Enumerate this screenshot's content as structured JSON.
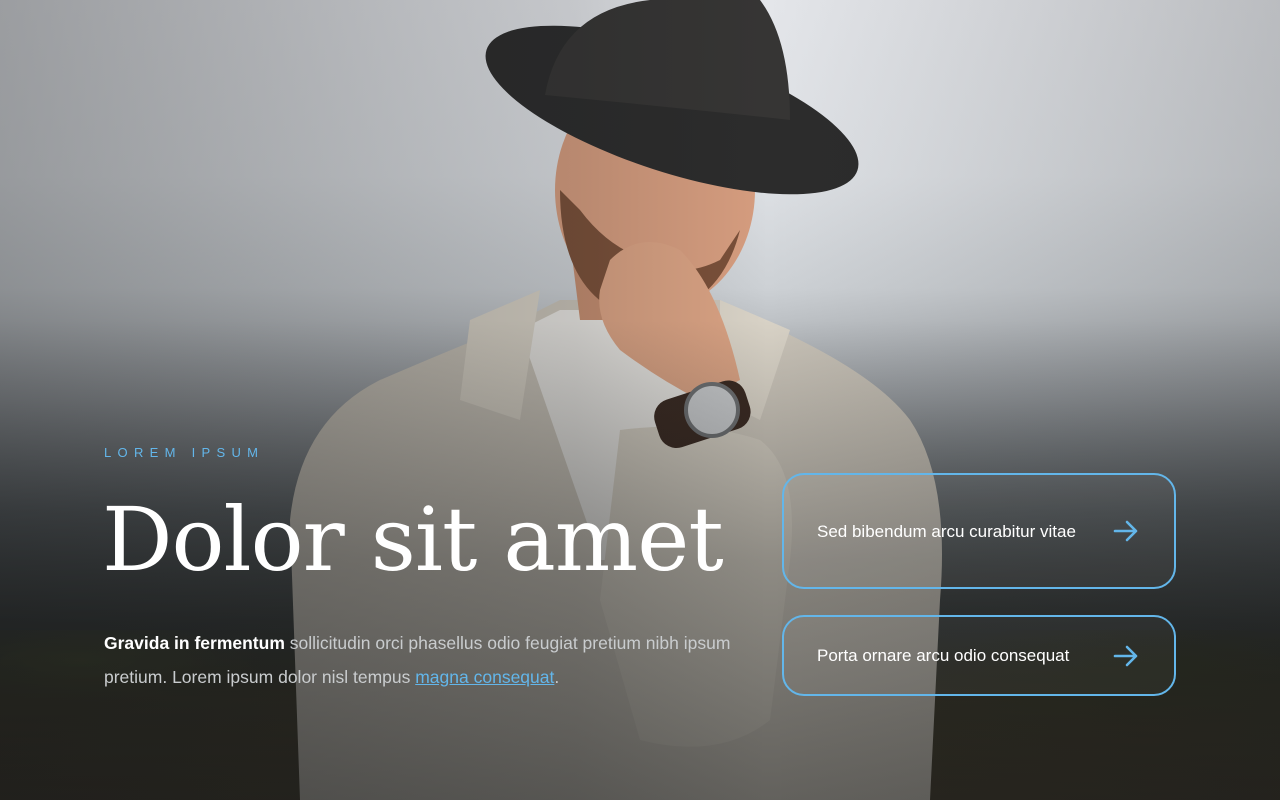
{
  "hero": {
    "eyebrow": "LOREM IPSUM",
    "title": "Dolor sit amet",
    "body": {
      "lead": "Gravida in fermentum",
      "text": " sollicitudin orci phasellus odio feugiat pretium nibh ipsum pretium. Lorem ipsum dolor nisl tempus ",
      "link": "magna consequat",
      "end": "."
    }
  },
  "actions": [
    {
      "label": "Sed bibendum arcu curabitur vitae",
      "icon": "arrow-right-icon"
    },
    {
      "label": "Porta ornare arcu odio consequat",
      "icon": "arrow-right-icon"
    }
  ],
  "colors": {
    "accent": "#63b6ea",
    "heading": "#ffffff",
    "body": "#c9ccce"
  }
}
